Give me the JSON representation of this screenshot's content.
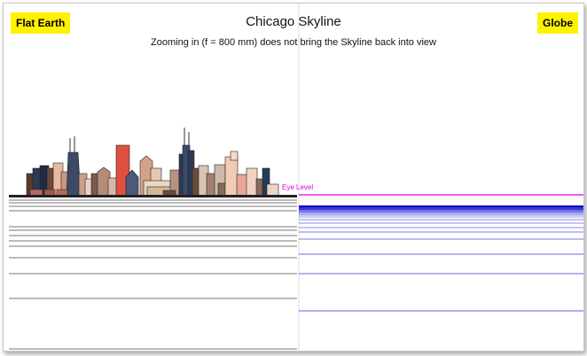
{
  "header": {
    "title": "Chicago Skyline",
    "subtitle": "Zooming in (f = 800 mm) does not bring the Skyline back into view",
    "left_label": "Flat Earth",
    "right_label": "Globe"
  },
  "annotations": {
    "eye_level": "Eye Level"
  },
  "colors": {
    "label_bg": "#fff200",
    "eye_level": "#e000e0",
    "globe_lines": "#3a3ad8",
    "flat_lines": "#777777"
  }
}
